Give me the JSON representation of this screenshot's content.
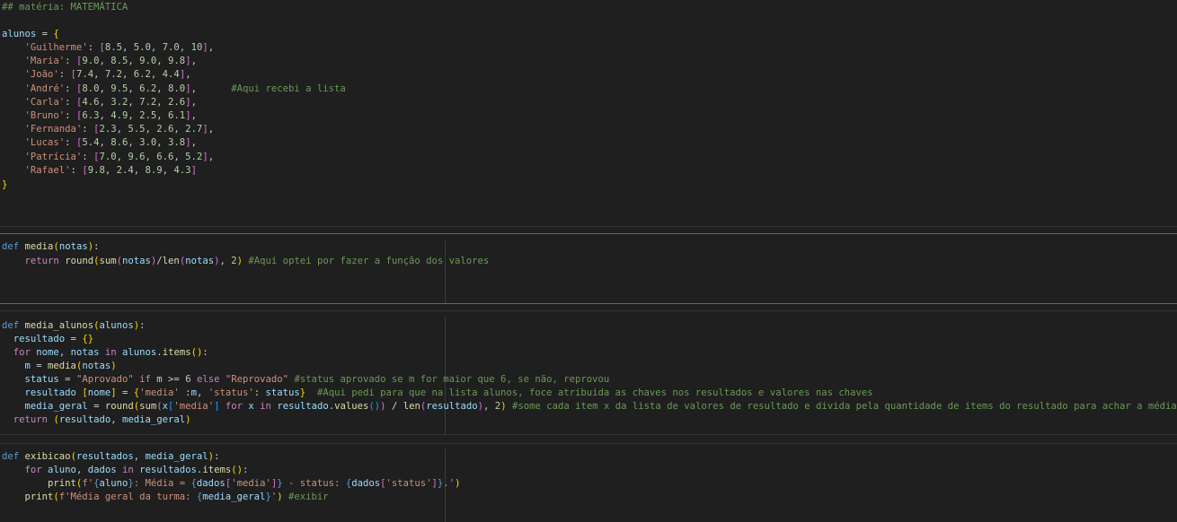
{
  "cell1": {
    "heading": "## matéria: MATEMÁTICA",
    "var_name": "alunos",
    "students": [
      {
        "name": "'Guilherme'",
        "grades": [
          "8.5",
          "5.0",
          "7.0",
          "10"
        ],
        "sep": ","
      },
      {
        "name": "'Maria'",
        "grades": [
          "9.0",
          "8.5",
          "9.0",
          "9.8"
        ],
        "sep": ","
      },
      {
        "name": "'João'",
        "grades": [
          "7.4",
          "7.2",
          "6.2",
          "4.4"
        ],
        "sep": ","
      },
      {
        "name": "'André'",
        "grades": [
          "8.0",
          "9.5",
          "6.2",
          "8.0"
        ],
        "sep": ",",
        "comment": "#Aqui recebi a lista"
      },
      {
        "name": "'Carla'",
        "grades": [
          "4.6",
          "3.2",
          "7.2",
          "2.6"
        ],
        "sep": ","
      },
      {
        "name": "'Bruno'",
        "grades": [
          "6.3",
          "4.9",
          "2.5",
          "6.1"
        ],
        "sep": ","
      },
      {
        "name": "'Fernanda'",
        "grades": [
          "2.3",
          "5.5",
          "2.6",
          "2.7"
        ],
        "sep": ","
      },
      {
        "name": "'Lucas'",
        "grades": [
          "5.4",
          "8.6",
          "3.0",
          "3.8"
        ],
        "sep": ","
      },
      {
        "name": "'Patrícia'",
        "grades": [
          "7.0",
          "9.6",
          "6.6",
          "5.2"
        ],
        "sep": ","
      },
      {
        "name": "'Rafael'",
        "grades": [
          "9.8",
          "2.4",
          "8.9",
          "4.3"
        ],
        "sep": ""
      }
    ]
  },
  "cell2": {
    "def": "def",
    "fn": "media",
    "param": "notas",
    "ret": "return",
    "round": "round",
    "sum": "sum",
    "len": "len",
    "two": "2",
    "comment": "#Aqui optei por fazer a função dos valores"
  },
  "cell3": {
    "def": "def",
    "fn": "media_alunos",
    "param": "alunos",
    "resultado": "resultado",
    "for": "for",
    "nome": "nome",
    "notas": "notas",
    "in": "in",
    "items": "items",
    "m": "m",
    "media_fn": "media",
    "status": "status",
    "aprovado": "\"Aprovado\"",
    "if": "if",
    "ge": ">=",
    "six": "6",
    "else": "else",
    "reprovado": "\"Reprovado\"",
    "c1": "#status aprovado se m for maior que 6, se não, reprovou",
    "k_media": "'media'",
    "k_status": "'status'",
    "c2": "#Aqui pedi para que na lista alunos, foce atribuida as chaves nos resultados e valores nas chaves",
    "media_geral": "media_geral",
    "round": "round",
    "sum": "sum",
    "x": "x",
    "values": "values",
    "len": "len",
    "two": "2",
    "c3": "#some cada item x da lista de valores de resultado e divida pela quantidade de items do resultado para achar a média",
    "ret": "return"
  },
  "cell4": {
    "def": "def",
    "fn": "exibicao",
    "p1": "resultados",
    "p2": "media_geral",
    "for": "for",
    "aluno": "aluno",
    "dados": "dados",
    "in": "in",
    "items": "items",
    "print": "print",
    "s1a": "f'",
    "s1b": ": Média = ",
    "s1c": " - status: ",
    "s1d": ".'",
    "k_media": "'media'",
    "k_status": "'status'",
    "s2a": "f'Média geral da turma: ",
    "s2b": "'",
    "comment": "#exibir"
  },
  "colors": {
    "background": "#1f1f1f",
    "comment": "#6a9955",
    "keyword": "#569cd6",
    "control": "#c586c0",
    "function": "#dcdcaa",
    "variable": "#9cdcfe",
    "string": "#ce9178",
    "number": "#b5cea8"
  }
}
